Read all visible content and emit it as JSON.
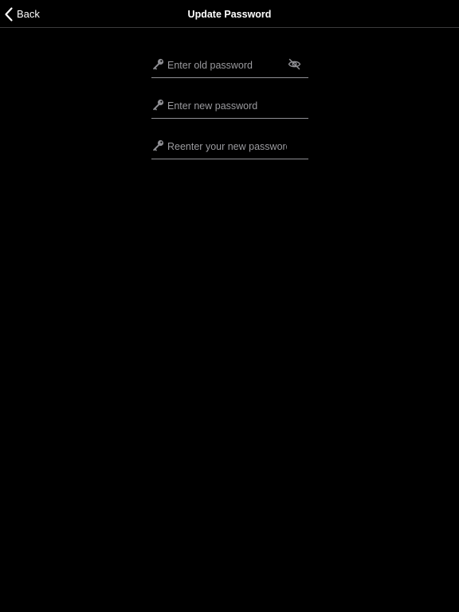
{
  "navbar": {
    "back_label": "Back",
    "title": "Update Password"
  },
  "form": {
    "old_password": {
      "placeholder": "Enter old password",
      "value": "",
      "icon": "key-icon",
      "toggle_icon": "eye-slash-icon"
    },
    "new_password": {
      "placeholder": "Enter new password",
      "value": "",
      "icon": "key-icon"
    },
    "confirm_password": {
      "placeholder": "Reenter your new password",
      "value": "",
      "icon": "key-icon"
    }
  },
  "colors": {
    "background": "#000000",
    "text": "#ffffff",
    "placeholder": "#9a9a9e",
    "underline": "#8e8e93",
    "icon": "#8e8e93"
  }
}
